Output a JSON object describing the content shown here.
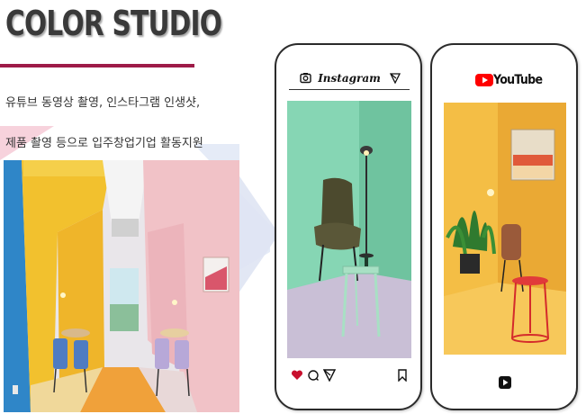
{
  "title": "COLOR STUDIO",
  "description_lines": [
    "유튜브 동영상 촬영, 인스타그램 인생샷,",
    "제품 촬영 등으로 입주창업기업 활동지원"
  ],
  "instagram_phone": {
    "app_name": "Instagram",
    "icons": [
      "camera-icon",
      "send-icon",
      "heart-icon",
      "comment-icon",
      "share-icon",
      "bookmark-icon"
    ]
  },
  "youtube_phone": {
    "app_name": "YouTube",
    "icons": [
      "youtube-logo-icon",
      "play-icon"
    ]
  },
  "colors": {
    "accent_rule": "#9e1b48",
    "title_text": "#3a3a3a",
    "mint_wall": "#7fd4b0",
    "yellow_wall": "#f1b73b",
    "pink_wall": "#f2c7c6"
  }
}
